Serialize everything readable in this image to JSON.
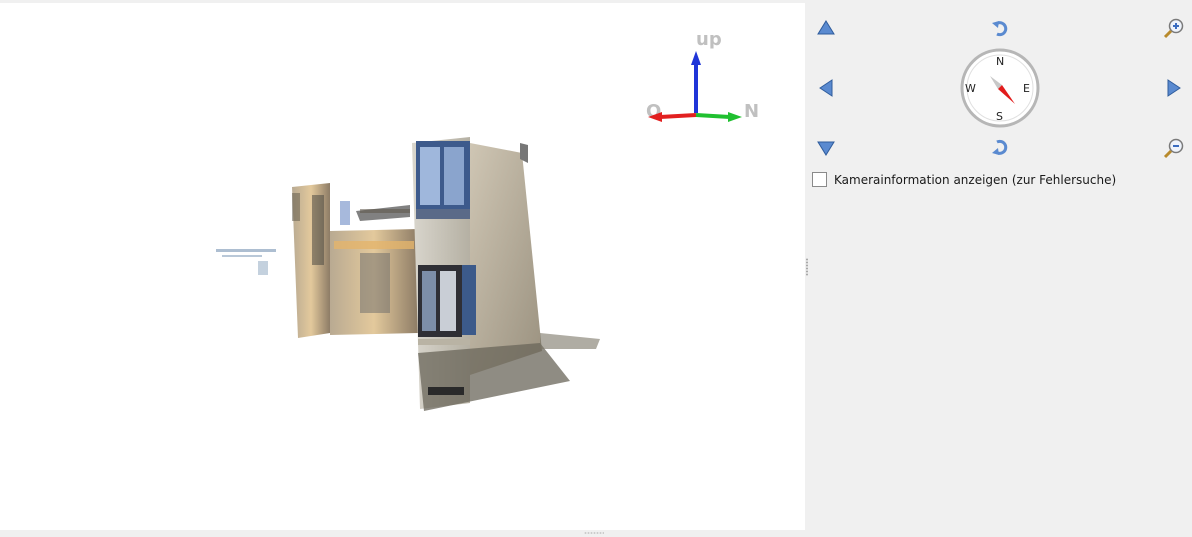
{
  "viewport": {
    "axes": {
      "up_label": "up",
      "west_label": "O",
      "north_label": "N"
    },
    "colors": {
      "up_axis": "#1f35d8",
      "west_axis": "#e22020",
      "north_axis": "#20c030"
    }
  },
  "navigation": {
    "buttons": [
      {
        "id": "pan-up",
        "icon": "triangle-up-icon"
      },
      {
        "id": "rotate-ccw",
        "icon": "rotate-ccw-icon"
      },
      {
        "id": "zoom-in",
        "icon": "zoom-in-icon"
      },
      {
        "id": "pan-left",
        "icon": "triangle-left-icon"
      },
      {
        "id": "pan-right",
        "icon": "triangle-right-icon"
      },
      {
        "id": "pan-down",
        "icon": "triangle-down-icon"
      },
      {
        "id": "rotate-cw",
        "icon": "rotate-cw-icon"
      },
      {
        "id": "zoom-out",
        "icon": "zoom-out-icon"
      }
    ],
    "compass": {
      "n": "N",
      "e": "E",
      "s": "S",
      "w": "W",
      "needle_color": "#e21c1c"
    },
    "icon_color": "#5a8ad0"
  },
  "camera_info": {
    "label": "Kamerainformation anzeigen (zur Fehlersuche)",
    "checked": false
  }
}
